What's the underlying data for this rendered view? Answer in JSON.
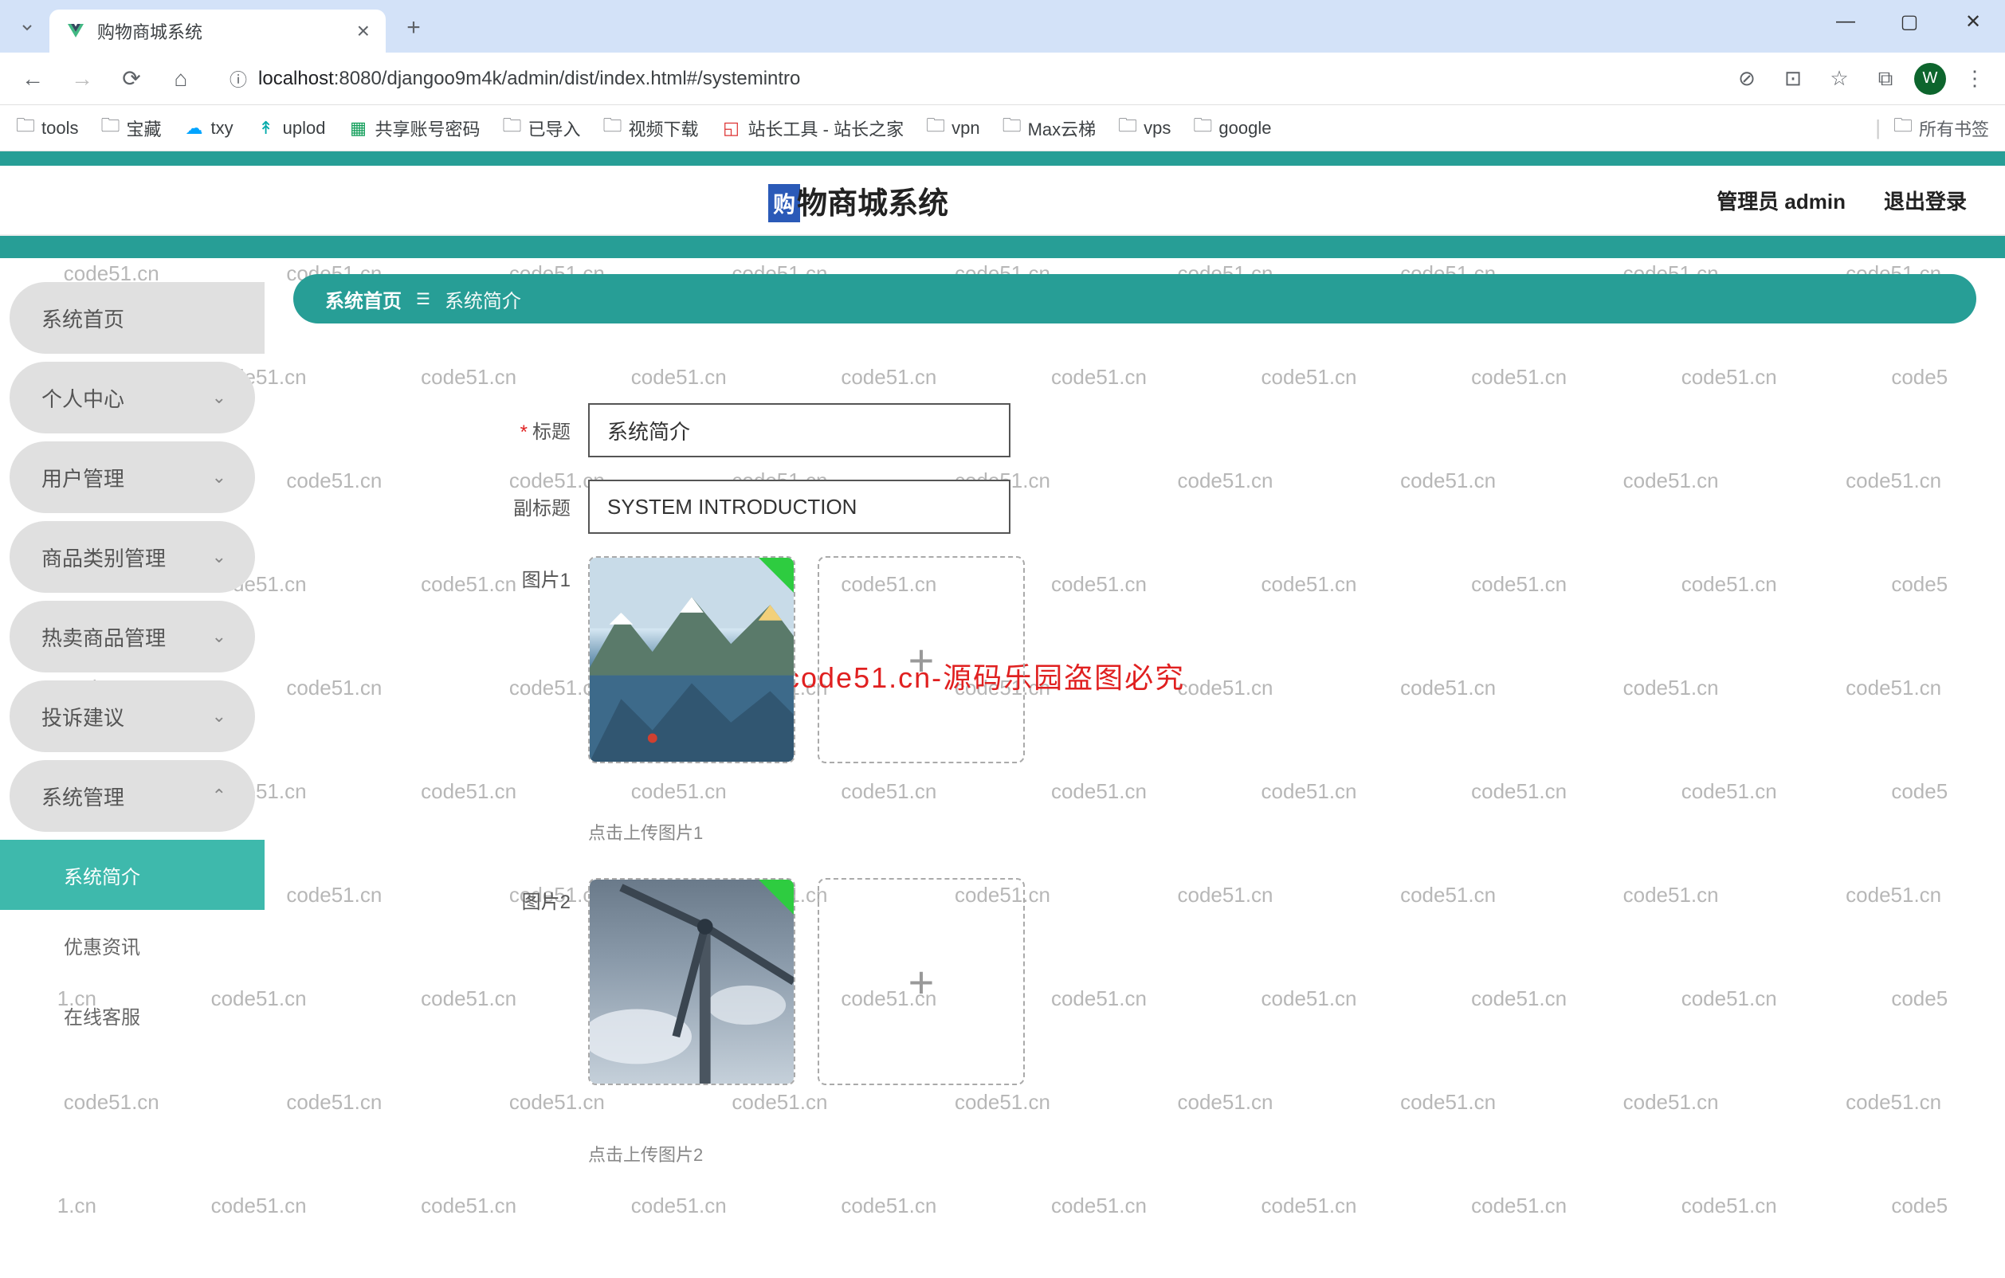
{
  "browser": {
    "tab_title": "购物商城系统",
    "url_host": "localhost",
    "url_path": ":8080/djangoo9m4k/admin/dist/index.html#/systemintro",
    "avatar": "W",
    "all_bookmarks": "所有书签",
    "bookmarks": [
      "tools",
      "宝藏",
      "txy",
      "uplod",
      "共享账号密码",
      "已导入",
      "视频下载",
      "站长工具 - 站长之家",
      "vpn",
      "Max云梯",
      "vps",
      "google"
    ]
  },
  "header": {
    "badge": "购",
    "title": "物商城系统",
    "user_label": "管理员 admin",
    "logout": "退出登录"
  },
  "sidebar": {
    "items": [
      {
        "label": "系统首页",
        "expandable": false
      },
      {
        "label": "个人中心",
        "expandable": true
      },
      {
        "label": "用户管理",
        "expandable": true
      },
      {
        "label": "商品类别管理",
        "expandable": true
      },
      {
        "label": "热卖商品管理",
        "expandable": true
      },
      {
        "label": "投诉建议",
        "expandable": true
      },
      {
        "label": "系统管理",
        "expandable": true,
        "expanded": true
      }
    ],
    "subitems": [
      {
        "label": "系统简介",
        "active": true
      },
      {
        "label": "优惠资讯",
        "active": false
      },
      {
        "label": "在线客服",
        "active": false
      }
    ]
  },
  "breadcrumb": {
    "home": "系统首页",
    "page": "系统简介"
  },
  "form": {
    "title_label": "标题",
    "title_value": "系统简介",
    "subtitle_label": "副标题",
    "subtitle_value": "SYSTEM INTRODUCTION",
    "image1_label": "图片1",
    "image1_hint": "点击上传图片1",
    "image2_label": "图片2",
    "image2_hint": "点击上传图片2"
  },
  "watermark": {
    "text": "code51.cn",
    "red": "code51.cn-源码乐园盗图必究"
  }
}
